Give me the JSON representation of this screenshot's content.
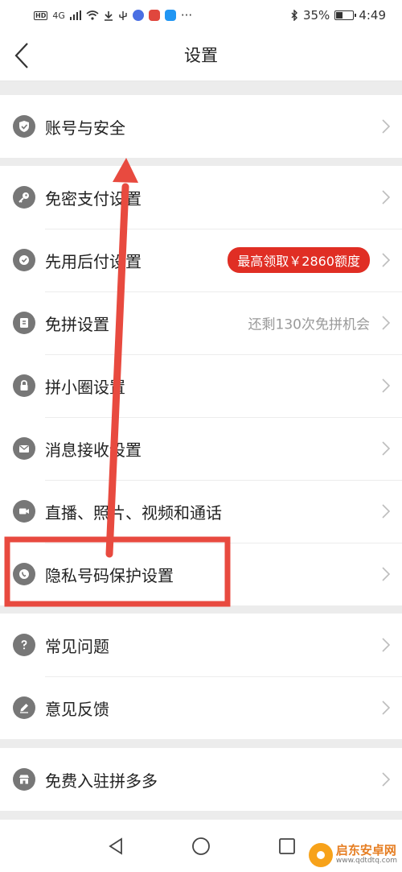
{
  "status_bar": {
    "hd_badge": "HD",
    "network": "4G",
    "battery_text": "35%",
    "battery_level": 0.35,
    "time": "4:49"
  },
  "header": {
    "title": "设置"
  },
  "sections": {
    "account": [
      {
        "label": "账号与安全",
        "icon": "shield-check-icon"
      }
    ],
    "main": [
      {
        "label": "免密支付设置",
        "icon": "key-icon"
      },
      {
        "label": "先用后付设置",
        "icon": "badge-icon",
        "pill": "最高领取￥2860额度"
      },
      {
        "label": "免拼设置",
        "icon": "coupon-icon",
        "hint": "还剩130次免拼机会"
      },
      {
        "label": "拼小圈设置",
        "icon": "lock-icon"
      },
      {
        "label": "消息接收设置",
        "icon": "mail-icon"
      },
      {
        "label": "直播、照片、视频和通话",
        "icon": "camera-icon"
      },
      {
        "label": "隐私号码保护设置",
        "icon": "phone-shield-icon"
      }
    ],
    "support": [
      {
        "label": "常见问题",
        "icon": "question-icon"
      },
      {
        "label": "意见反馈",
        "icon": "pen-icon"
      }
    ],
    "merchant": [
      {
        "label": "免费入驻拼多多",
        "icon": "store-icon"
      }
    ]
  },
  "colors": {
    "accent_red": "#e02e24",
    "annotation_red": "#e84a3f",
    "icon_gray": "#777777",
    "hint_gray": "#9a9a9a"
  },
  "watermark": {
    "name": "启东安卓网",
    "url": "www.qdtdtq.com"
  }
}
